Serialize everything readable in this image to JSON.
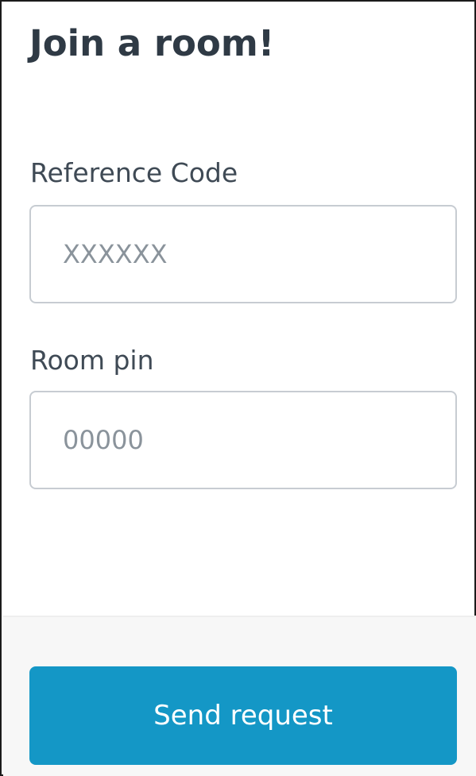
{
  "dialog": {
    "title": "Join a room!",
    "reference_code": {
      "label": "Reference Code",
      "placeholder": "XXXXXX",
      "value": ""
    },
    "room_pin": {
      "label": "Room pin",
      "placeholder": "00000",
      "value": ""
    },
    "send_button_label": "Send request"
  },
  "colors": {
    "title_text": "#2f3a45",
    "label_text": "#3f4a55",
    "placeholder_text": "#8a939b",
    "input_border": "#c7ccd2",
    "footer_background": "#f7f7f7",
    "button_background": "#1497c6",
    "button_text": "#ffffff"
  }
}
